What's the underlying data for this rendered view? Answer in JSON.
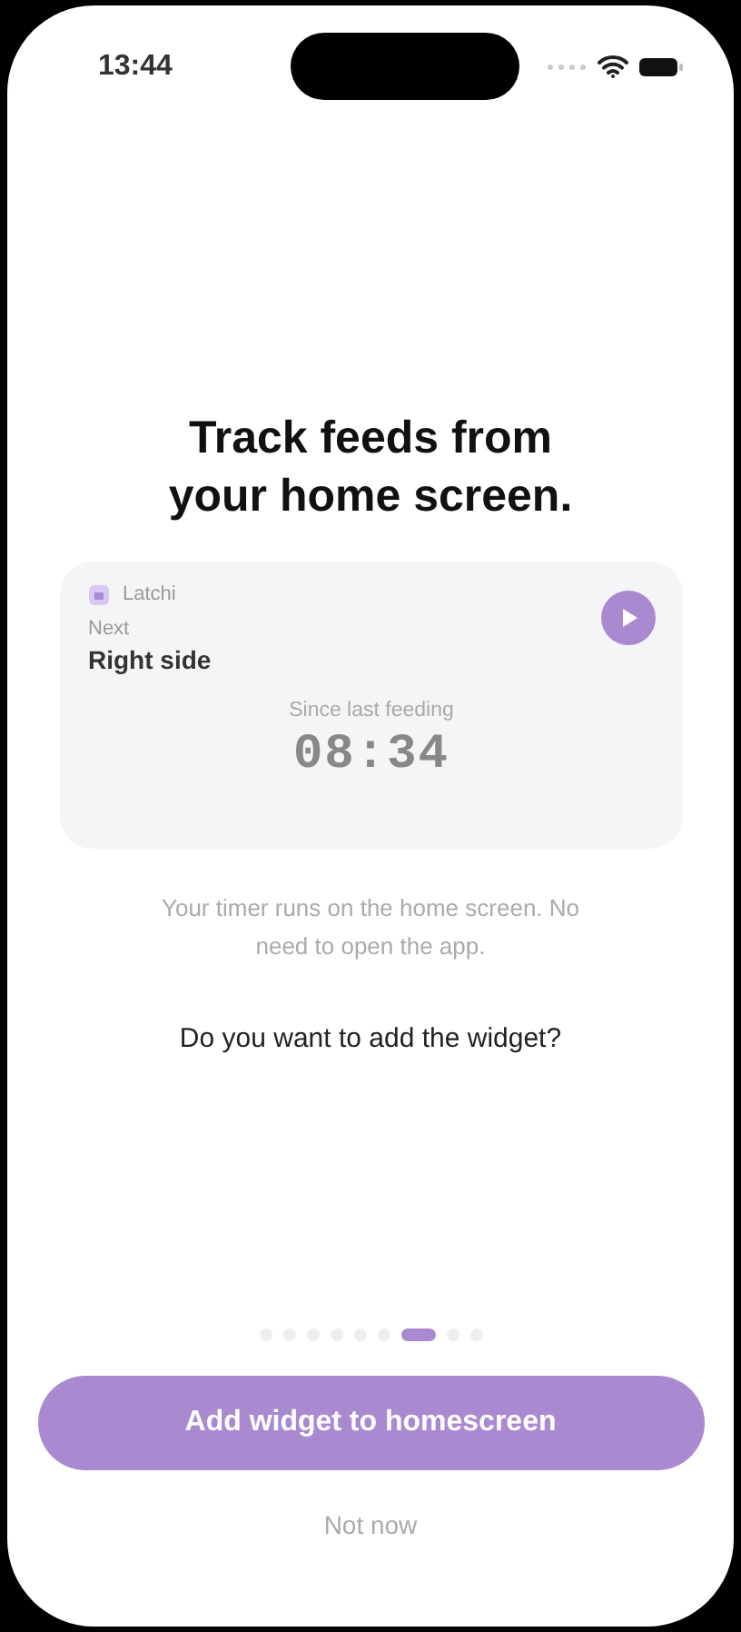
{
  "status_bar": {
    "time": "13:44"
  },
  "title": "Track feeds from your home screen.",
  "widget": {
    "app_name": "Latchi",
    "next_label": "Next",
    "next_value": "Right side",
    "timer_label": "Since last feeding",
    "timer": "08:34"
  },
  "caption": "Your timer runs on the home screen. No need to open the app.",
  "question": "Do you want to add the widget?",
  "pages": [
    {
      "selected": false
    },
    {
      "selected": false
    },
    {
      "selected": false
    },
    {
      "selected": false
    },
    {
      "selected": false
    },
    {
      "selected": false
    },
    {
      "selected": true
    },
    {
      "selected": false
    },
    {
      "selected": false
    }
  ],
  "primary_button": "Add widget to homescreen",
  "secondary_button": "Not now"
}
